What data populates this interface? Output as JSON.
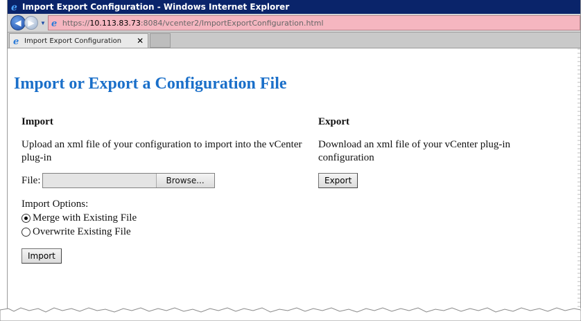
{
  "window": {
    "title": "Import Export Configuration - Windows Internet Explorer"
  },
  "addressbar": {
    "url_prefix": "https://",
    "url_host": "10.113.83.73",
    "url_rest": ":8084/vcenter2/ImportExportConfiguration.html"
  },
  "tab": {
    "label": "Import Export Configuration",
    "close": "✕"
  },
  "page": {
    "title": "Import or Export a Configuration File",
    "import": {
      "heading": "Import",
      "description": "Upload an xml file of your configuration to import into the vCenter plug-in",
      "file_label": "File:",
      "browse_label": "Browse...",
      "options_label": "Import Options:",
      "option_merge": "Merge with Existing File",
      "option_overwrite": "Overwrite Existing File",
      "import_button": "Import"
    },
    "export": {
      "heading": "Export",
      "description": "Download an xml file of your vCenter plug-in configuration",
      "export_button": "Export"
    }
  },
  "colors": {
    "title_blue": "#1a6fc9",
    "titlebar": "#0a246a",
    "url_bg": "#f5b6c0"
  }
}
